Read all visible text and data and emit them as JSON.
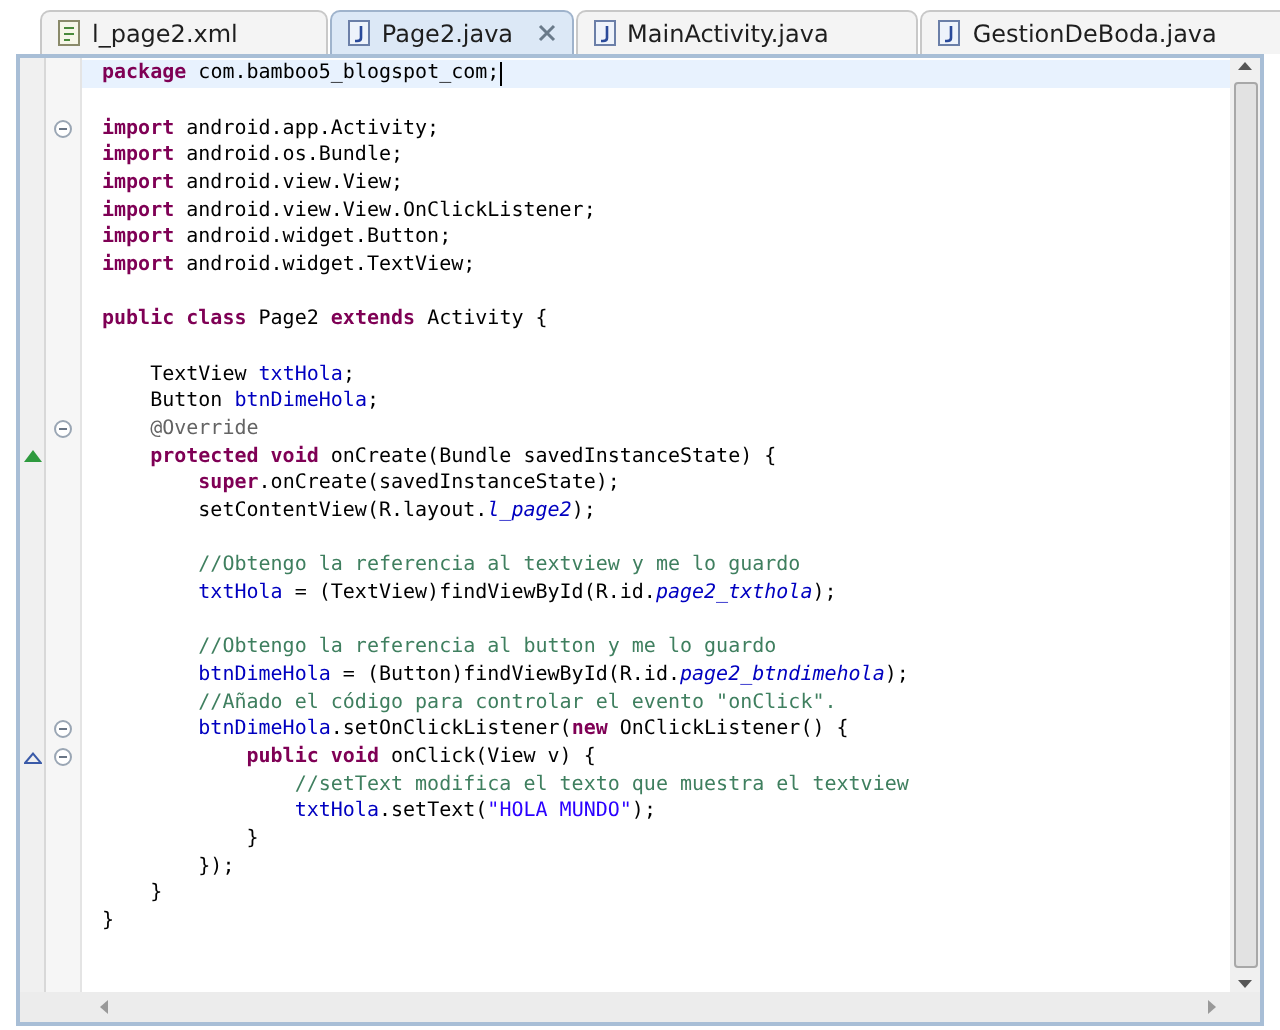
{
  "tabs": [
    {
      "label": "l_page2.xml",
      "kind": "xml",
      "selected": false
    },
    {
      "label": "Page2.java",
      "kind": "java",
      "selected": true
    },
    {
      "label": "MainActivity.java",
      "kind": "java",
      "selected": false
    },
    {
      "label": "GestionDeBoda.java",
      "kind": "java",
      "selected": false
    }
  ],
  "editor": {
    "lines": [
      {
        "current": true,
        "fold": false,
        "tokens": [
          {
            "kind": "keyword",
            "text": "package"
          },
          {
            "kind": "plain",
            "text": " com.bamboo5_blogspot_com;"
          }
        ]
      },
      {
        "current": false,
        "fold": false
      },
      {
        "current": false,
        "fold": true,
        "tokens": [
          {
            "kind": "keyword",
            "text": "import"
          },
          {
            "kind": "plain",
            "text": " android.app.Activity;"
          }
        ]
      },
      {
        "current": false,
        "fold": false,
        "tokens": [
          {
            "kind": "keyword",
            "text": "import"
          },
          {
            "kind": "plain",
            "text": " android.os.Bundle;"
          }
        ]
      },
      {
        "current": false,
        "fold": false,
        "tokens": [
          {
            "kind": "keyword",
            "text": "import"
          },
          {
            "kind": "plain",
            "text": " android.view.View;"
          }
        ]
      },
      {
        "current": false,
        "fold": false,
        "tokens": [
          {
            "kind": "keyword",
            "text": "import"
          },
          {
            "kind": "plain",
            "text": " android.view.View.OnClickListener;"
          }
        ]
      },
      {
        "current": false,
        "fold": false,
        "tokens": [
          {
            "kind": "keyword",
            "text": "import"
          },
          {
            "kind": "plain",
            "text": " android.widget.Button;"
          }
        ]
      },
      {
        "current": false,
        "fold": false,
        "tokens": [
          {
            "kind": "keyword",
            "text": "import"
          },
          {
            "kind": "plain",
            "text": " android.widget.TextView;"
          }
        ]
      },
      {
        "current": false,
        "fold": false
      },
      {
        "current": false,
        "fold": false,
        "tokens": [
          {
            "kind": "keyword",
            "text": "public class"
          },
          {
            "kind": "plain",
            "text": " Page2 "
          },
          {
            "kind": "keyword",
            "text": "extends"
          },
          {
            "kind": "plain",
            "text": " Activity {"
          }
        ]
      },
      {
        "current": false,
        "fold": false
      },
      {
        "current": false,
        "fold": false,
        "tokens": [
          {
            "kind": "plain",
            "text": "    TextView "
          },
          {
            "kind": "field",
            "text": "txtHola"
          },
          {
            "kind": "plain",
            "text": ";"
          }
        ]
      },
      {
        "current": false,
        "fold": false,
        "tokens": [
          {
            "kind": "plain",
            "text": "    Button "
          },
          {
            "kind": "field",
            "text": "btnDimeHola"
          },
          {
            "kind": "plain",
            "text": ";"
          }
        ]
      },
      {
        "current": false,
        "fold": true,
        "tokens": [
          {
            "kind": "annotation",
            "text": "    @Override"
          }
        ]
      },
      {
        "current": false,
        "fold": false,
        "marker": {
          "kind": "override"
        },
        "tokens": [
          {
            "kind": "keyword",
            "text": "    protected void"
          },
          {
            "kind": "plain",
            "text": " onCreate(Bundle savedInstanceState) {"
          }
        ]
      },
      {
        "current": false,
        "fold": false,
        "tokens": [
          {
            "kind": "keyword",
            "text": "        super"
          },
          {
            "kind": "plain",
            "text": ".onCreate(savedInstanceState);"
          }
        ]
      },
      {
        "current": false,
        "fold": false,
        "tokens": [
          {
            "kind": "plain",
            "text": "        setContentView(R.layout."
          },
          {
            "kind": "static",
            "text": "l_page2"
          },
          {
            "kind": "plain",
            "text": ");"
          }
        ]
      },
      {
        "current": false,
        "fold": false
      },
      {
        "current": false,
        "fold": false,
        "tokens": [
          {
            "kind": "comment",
            "text": "        //Obtengo la referencia al textview y me lo guardo"
          }
        ]
      },
      {
        "current": false,
        "fold": false,
        "tokens": [
          {
            "kind": "field",
            "text": "        txtHola"
          },
          {
            "kind": "plain",
            "text": " = (TextView)findViewById(R.id."
          },
          {
            "kind": "static",
            "text": "page2_txthola"
          },
          {
            "kind": "plain",
            "text": ");"
          }
        ]
      },
      {
        "current": false,
        "fold": false
      },
      {
        "current": false,
        "fold": false,
        "tokens": [
          {
            "kind": "comment",
            "text": "        //Obtengo la referencia al button y me lo guardo"
          }
        ]
      },
      {
        "current": false,
        "fold": false,
        "tokens": [
          {
            "kind": "field",
            "text": "        btnDimeHola"
          },
          {
            "kind": "plain",
            "text": " = (Button)findViewById(R.id."
          },
          {
            "kind": "static",
            "text": "page2_btndimehola"
          },
          {
            "kind": "plain",
            "text": ");"
          }
        ]
      },
      {
        "current": false,
        "fold": false,
        "tokens": [
          {
            "kind": "comment",
            "text": "        //Añado el código para controlar el evento \"onClick\"."
          }
        ]
      },
      {
        "current": false,
        "fold": true,
        "tokens": [
          {
            "kind": "field",
            "text": "        btnDimeHola"
          },
          {
            "kind": "plain",
            "text": ".setOnClickListener("
          },
          {
            "kind": "keyword",
            "text": "new"
          },
          {
            "kind": "plain",
            "text": " OnClickListener() {"
          }
        ]
      },
      {
        "current": false,
        "fold": true,
        "marker": {
          "kind": "implements"
        },
        "tokens": [
          {
            "kind": "keyword",
            "text": "            public void"
          },
          {
            "kind": "plain",
            "text": " onClick(View v) {"
          }
        ]
      },
      {
        "current": false,
        "fold": false,
        "tokens": [
          {
            "kind": "comment",
            "text": "                //setText modifica el texto que muestra el textview"
          }
        ]
      },
      {
        "current": false,
        "fold": false,
        "tokens": [
          {
            "kind": "field",
            "text": "                txtHola"
          },
          {
            "kind": "plain",
            "text": ".setText("
          },
          {
            "kind": "string",
            "text": "\"HOLA MUNDO\""
          },
          {
            "kind": "plain",
            "text": ");"
          }
        ]
      },
      {
        "current": false,
        "fold": false,
        "tokens": [
          {
            "kind": "plain",
            "text": "            }"
          }
        ]
      },
      {
        "current": false,
        "fold": false,
        "tokens": [
          {
            "kind": "plain",
            "text": "        });"
          }
        ]
      },
      {
        "current": false,
        "fold": false,
        "tokens": [
          {
            "kind": "plain",
            "text": "    }"
          }
        ]
      },
      {
        "current": false,
        "fold": false,
        "tokens": [
          {
            "kind": "plain",
            "text": "}"
          }
        ]
      }
    ]
  }
}
